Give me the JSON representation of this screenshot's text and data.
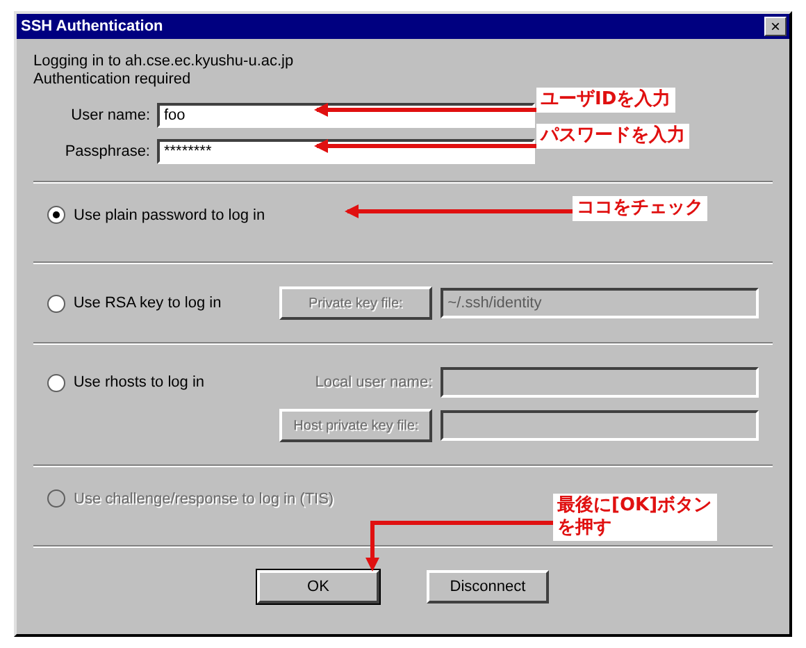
{
  "window": {
    "title": "SSH Authentication",
    "close": "×"
  },
  "info": [
    "Logging in to ah.cse.ec.kyushu-u.ac.jp",
    "Authentication required"
  ],
  "fields": [
    {
      "label": "User name:",
      "value": "foo"
    },
    {
      "label": "Passphrase:",
      "value": "********"
    }
  ],
  "options": [
    {
      "label": "Use plain password to log in",
      "selected": true,
      "disabled": false
    },
    {
      "label": "Use RSA key to log in",
      "selected": false,
      "disabled": false,
      "button": "Private key file:",
      "field": "~/.ssh/identity"
    },
    {
      "label": "Use rhosts to log in",
      "selected": false,
      "disabled": false,
      "field_label": "Local user name:",
      "button": "Host private key file:"
    },
    {
      "label": "Use challenge/response to log in (TIS)",
      "selected": false,
      "disabled": true
    }
  ],
  "buttons": [
    "OK",
    "Disconnect"
  ],
  "annotations": [
    "ユーザIDを入力",
    "パスワードを入力",
    "ココをチェック",
    "最後に[OK]ボタンを押す"
  ]
}
